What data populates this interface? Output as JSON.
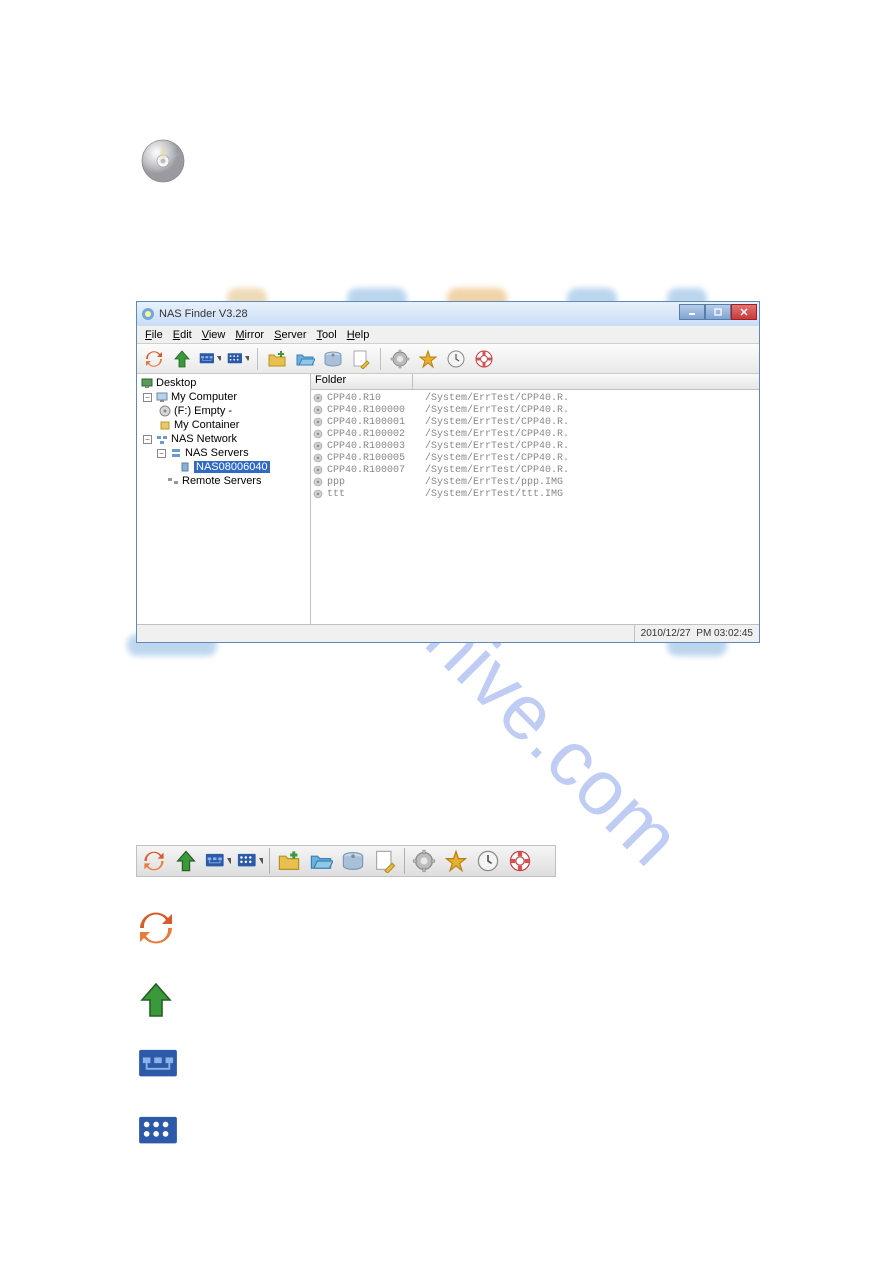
{
  "watermark": "manualshive.com",
  "app": {
    "title": "NAS Finder V3.28",
    "menu": [
      "File",
      "Edit",
      "View",
      "Mirror",
      "Server",
      "Tool",
      "Help"
    ],
    "tree": {
      "root": "Desktop",
      "items": [
        "My Computer",
        "(F:) Empty -",
        "My Container",
        "NAS Network",
        "NAS Servers",
        "NAS08006040",
        "Remote Servers"
      ]
    },
    "right_header": "Folder",
    "files": [
      {
        "name": "CPP40.R10",
        "path": "/System/ErrTest/CPP40.R."
      },
      {
        "name": "CPP40.R100000",
        "path": "/System/ErrTest/CPP40.R."
      },
      {
        "name": "CPP40.R100001",
        "path": "/System/ErrTest/CPP40.R."
      },
      {
        "name": "CPP40.R100002",
        "path": "/System/ErrTest/CPP40.R."
      },
      {
        "name": "CPP40.R100003",
        "path": "/System/ErrTest/CPP40.R."
      },
      {
        "name": "CPP40.R100005",
        "path": "/System/ErrTest/CPP40.R."
      },
      {
        "name": "CPP40.R100007",
        "path": "/System/ErrTest/CPP40.R."
      },
      {
        "name": "ppp",
        "path": "/System/ErrTest/ppp.IMG"
      },
      {
        "name": "ttt",
        "path": "/System/ErrTest/ttt.IMG"
      }
    ],
    "status": {
      "date": "2010/12/27",
      "time": "PM 03:02:45"
    }
  },
  "toolbar_icons": [
    "refresh-icon",
    "up-icon",
    "net-icon",
    "list-icon",
    "newfolder-icon",
    "open-icon",
    "hdd-icon",
    "edit-icon",
    "gear-icon",
    "star-icon",
    "clock-icon",
    "lifebuoy-icon"
  ],
  "legend": {
    "refresh": "refresh-icon",
    "up": "up-icon",
    "net": "net-icon",
    "list": "list-icon"
  }
}
